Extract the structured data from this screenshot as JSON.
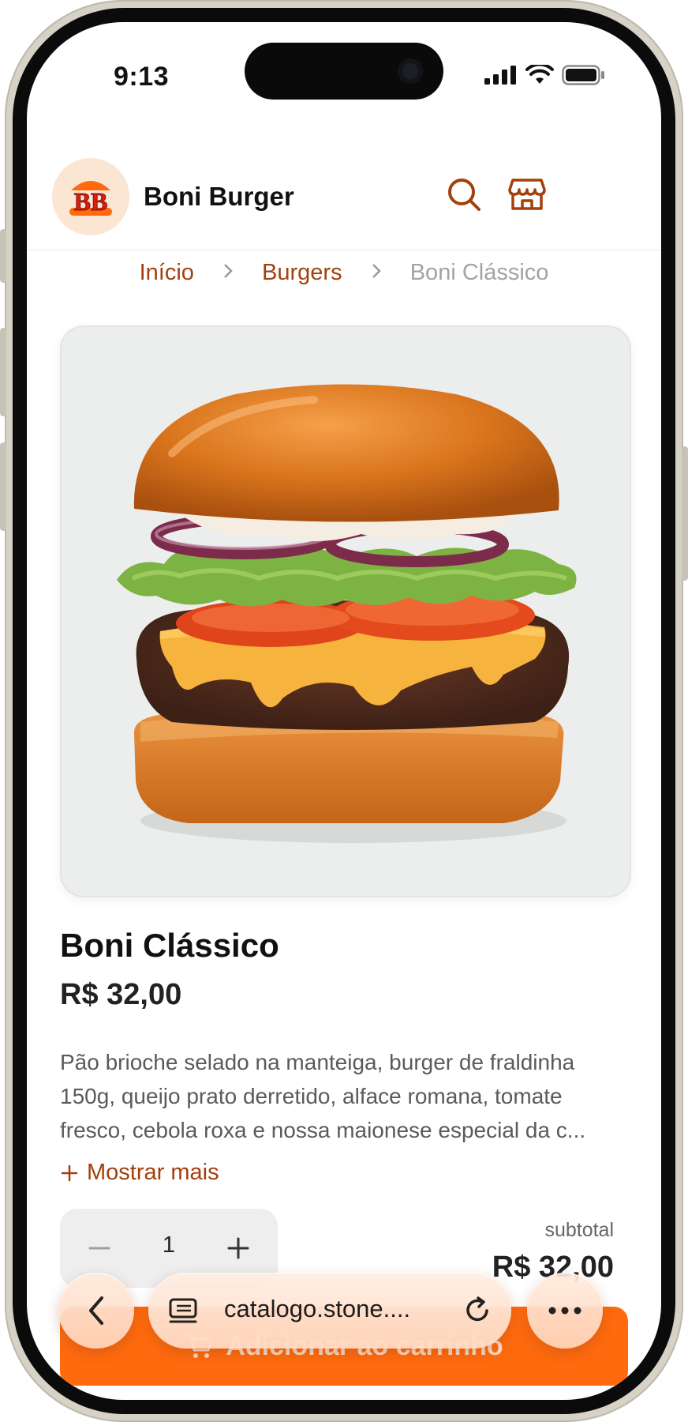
{
  "status_bar": {
    "time": "9:13"
  },
  "header": {
    "logo_text": "BB",
    "brand_name": "Boni Burger",
    "icons": [
      "search-icon",
      "store-icon"
    ]
  },
  "breadcrumb": {
    "items": [
      "Início",
      "Burgers",
      "Boni Clássico"
    ]
  },
  "product": {
    "image_icon": "burger-image",
    "title": "Boni Clássico",
    "price": "R$ 32,00",
    "description": "Pão brioche selado na manteiga, burger de fraldinha 150g, queijo prato derretido, alface romana, tomate fresco, cebola roxa e nossa maionese especial da c...",
    "show_more": "Mostrar mais"
  },
  "order": {
    "quantity": "1",
    "subtotal_label": "subtotal",
    "subtotal_value": "R$ 32,00"
  },
  "add_to_cart": {
    "label": "Adicionar ao carrinho"
  },
  "browser": {
    "url": "catalogo.stone....",
    "icons": [
      "back-icon",
      "tabs-icon",
      "reload-icon",
      "more-icon"
    ]
  },
  "colors": {
    "accent": "#ff6a0f",
    "accent_dark": "#a3400c",
    "logo_bg": "#fbe6d4"
  }
}
